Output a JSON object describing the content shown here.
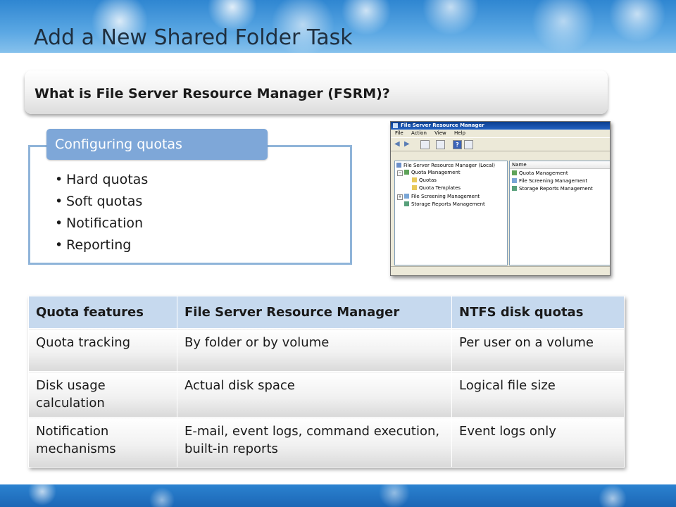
{
  "slide": {
    "title": "Add a New Shared Folder Task",
    "subtitle": "What is File Server Resource Manager (FSRM)?"
  },
  "quotas": {
    "heading": "Configuring quotas",
    "items": [
      "Hard quotas",
      "Soft quotas",
      "Notification",
      "Reporting"
    ]
  },
  "screenshot": {
    "window_title": "File Server Resource Manager",
    "menu": [
      "File",
      "Action",
      "View",
      "Help"
    ],
    "tree": [
      {
        "label": "File Server Resource Manager (Local)",
        "icon": "server-icon"
      },
      {
        "label": "Quota Management",
        "icon": "quota-icon"
      },
      {
        "label": "Quotas",
        "icon": "document-icon"
      },
      {
        "label": "Quota Templates",
        "icon": "document-icon"
      },
      {
        "label": "File Screening Management",
        "icon": "screen-icon"
      },
      {
        "label": "Storage Reports Management",
        "icon": "report-icon"
      }
    ],
    "list_header": "Name",
    "list_items": [
      {
        "label": "Quota Management",
        "icon": "quota-icon"
      },
      {
        "label": "File Screening Management",
        "icon": "screen-icon"
      },
      {
        "label": "Storage Reports Management",
        "icon": "report-icon"
      }
    ]
  },
  "table": {
    "headers": [
      "Quota features",
      "File Server Resource Manager",
      "NTFS disk quotas"
    ],
    "rows": [
      [
        "Quota tracking",
        "By folder or by volume",
        "Per user on a volume"
      ],
      [
        "Disk usage calculation",
        "Actual disk space",
        "Logical file size"
      ],
      [
        "Notification mechanisms",
        "E-mail, event logs, command execution, built-in reports",
        "Event logs only"
      ]
    ]
  },
  "colors": {
    "banner": "#2f86d1",
    "tab": "#7ea7d8",
    "box_border": "#8fb4d9",
    "table_header": "#c6d9ee"
  }
}
